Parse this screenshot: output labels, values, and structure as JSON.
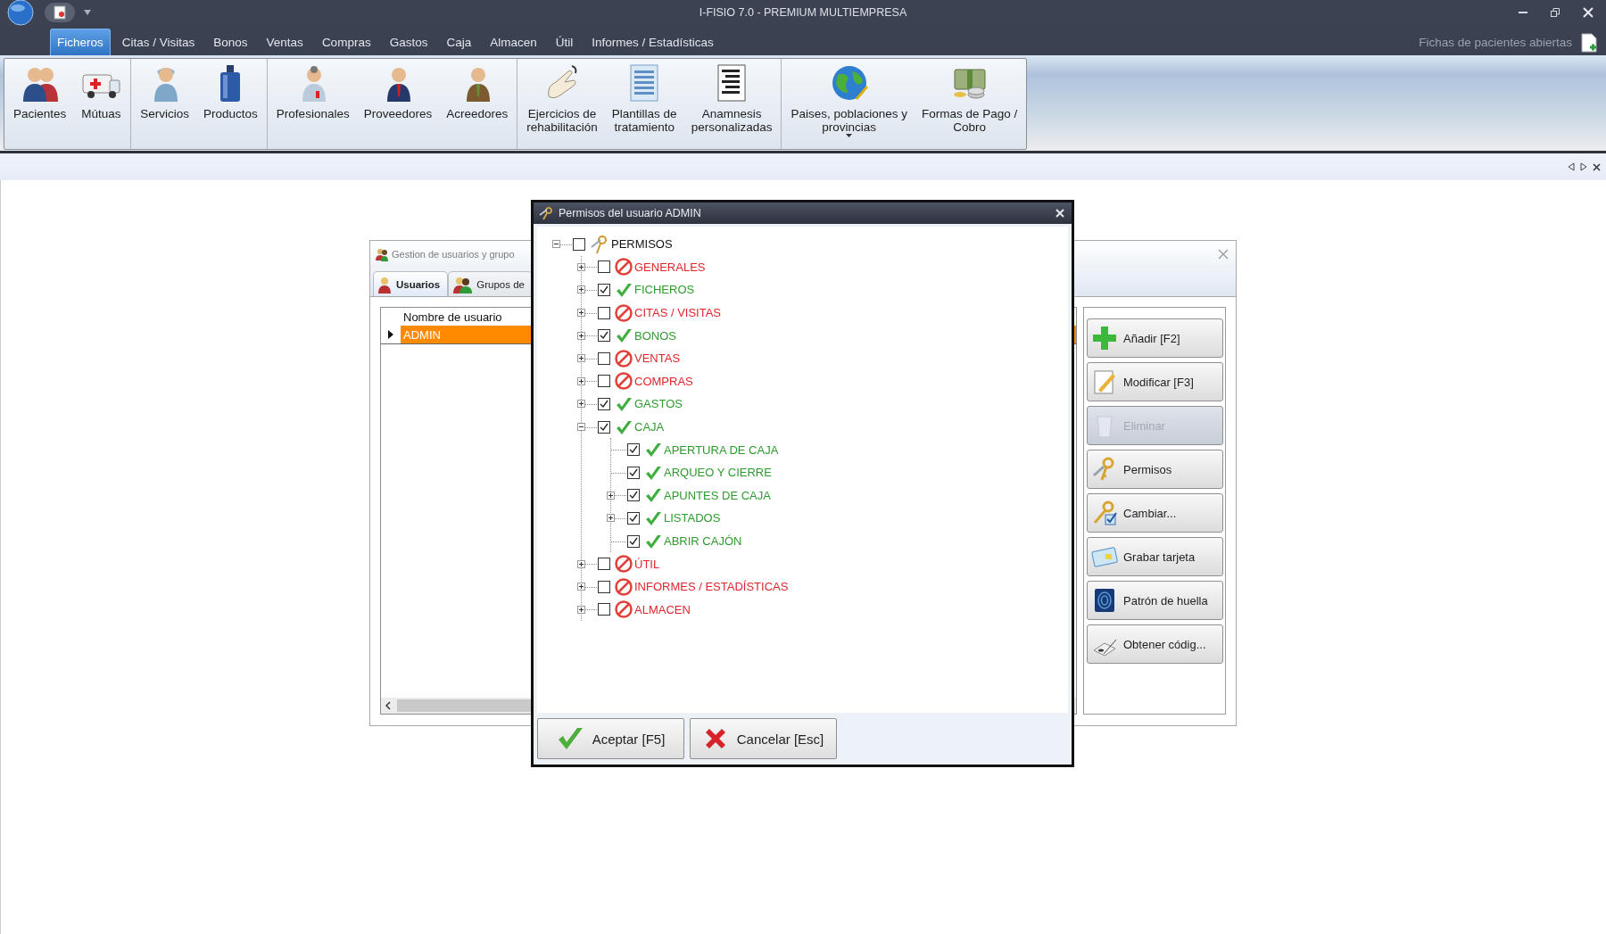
{
  "app": {
    "title": "I-FISIO 7.0 - PREMIUM MULTIEMPRESA"
  },
  "menu": [
    {
      "label": "Ficheros",
      "selected": true
    },
    {
      "label": "Citas / Visitas",
      "selected": false
    },
    {
      "label": "Bonos",
      "selected": false
    },
    {
      "label": "Ventas",
      "selected": false
    },
    {
      "label": "Compras",
      "selected": false
    },
    {
      "label": "Gastos",
      "selected": false
    },
    {
      "label": "Caja",
      "selected": false
    },
    {
      "label": "Almacen",
      "selected": false
    },
    {
      "label": "Útil",
      "selected": false
    },
    {
      "label": "Informes / Estadísticas",
      "selected": false
    }
  ],
  "open_records": {
    "label": "Fichas de pacientes abiertas"
  },
  "ribbon": {
    "groups": [
      {
        "items": [
          {
            "label": "Pacientes",
            "has_menu": false
          },
          {
            "label": "Mútuas",
            "has_menu": false
          }
        ]
      },
      {
        "items": [
          {
            "label": "Servicios",
            "has_menu": false
          },
          {
            "label": "Productos",
            "has_menu": false
          }
        ]
      },
      {
        "items": [
          {
            "label": "Profesionales",
            "has_menu": false
          },
          {
            "label": "Proveedores",
            "has_menu": false
          },
          {
            "label": "Acreedores",
            "has_menu": false
          }
        ]
      },
      {
        "items": [
          {
            "label": "Ejercicios de\nrehabilitación",
            "has_menu": false
          },
          {
            "label": "Plantillas de\ntratamiento",
            "has_menu": false
          },
          {
            "label": "Anamnesis\npersonalizadas",
            "has_menu": false
          }
        ]
      },
      {
        "items": [
          {
            "label": "Paises, poblaciones y\nprovincias",
            "has_menu": true
          },
          {
            "label": "Formas de Pago /\nCobro",
            "has_menu": false
          }
        ]
      }
    ]
  },
  "users_window": {
    "title": "Gestion de usuarios y grupo",
    "tabs": [
      {
        "label": "Usuarios",
        "selected": true
      },
      {
        "label": "Grupos de",
        "selected": false
      }
    ],
    "table": {
      "columns": [
        "Nombre de usuario"
      ],
      "rows": [
        {
          "cells": [
            "ADMIN"
          ],
          "selected": true
        }
      ]
    },
    "buttons": [
      {
        "label": "Añadir [F2]",
        "disabled": false
      },
      {
        "label": "Modificar [F3]",
        "disabled": false
      },
      {
        "label": "Eliminar",
        "disabled": true
      },
      {
        "label": "Permisos",
        "disabled": false
      },
      {
        "label": "Cambiar...",
        "disabled": false
      },
      {
        "label": "Grabar tarjeta",
        "disabled": false
      },
      {
        "label": "Patrón de huella",
        "disabled": false
      },
      {
        "label": "Obtener códig...",
        "disabled": false
      }
    ]
  },
  "permissions_dialog": {
    "title": "Permisos del usuario ADMIN",
    "tree": {
      "label": "PERMISOS",
      "checked": false,
      "expandable": true,
      "expanded": true,
      "children": [
        {
          "label": "GENERALES",
          "checked": false,
          "expandable": true,
          "expanded": false
        },
        {
          "label": "FICHEROS",
          "checked": true,
          "expandable": true,
          "expanded": false
        },
        {
          "label": "CITAS / VISITAS",
          "checked": false,
          "expandable": true,
          "expanded": false
        },
        {
          "label": "BONOS",
          "checked": true,
          "expandable": true,
          "expanded": false
        },
        {
          "label": "VENTAS",
          "checked": false,
          "expandable": true,
          "expanded": false
        },
        {
          "label": "COMPRAS",
          "checked": false,
          "expandable": true,
          "expanded": false
        },
        {
          "label": "GASTOS",
          "checked": true,
          "expandable": true,
          "expanded": false
        },
        {
          "label": "CAJA",
          "checked": true,
          "expandable": true,
          "expanded": true,
          "children": [
            {
              "label": "APERTURA DE CAJA",
              "checked": true,
              "expandable": false,
              "expanded": false
            },
            {
              "label": "ARQUEO Y CIERRE",
              "checked": true,
              "expandable": false,
              "expanded": false
            },
            {
              "label": "APUNTES DE CAJA",
              "checked": true,
              "expandable": true,
              "expanded": false
            },
            {
              "label": "LISTADOS",
              "checked": true,
              "expandable": true,
              "expanded": false
            },
            {
              "label": "ABRIR CAJÓN",
              "checked": true,
              "expandable": false,
              "expanded": false
            }
          ]
        },
        {
          "label": "ÚTIL",
          "checked": false,
          "expandable": true,
          "expanded": false
        },
        {
          "label": "INFORMES / ESTADÍSTICAS",
          "checked": false,
          "expandable": true,
          "expanded": false
        },
        {
          "label": "ALMACEN",
          "checked": false,
          "expandable": true,
          "expanded": false
        }
      ]
    },
    "buttons": [
      {
        "label": "Aceptar [F5]",
        "kind": "accept"
      },
      {
        "label": "Cancelar [Esc]",
        "kind": "cancel"
      }
    ]
  }
}
